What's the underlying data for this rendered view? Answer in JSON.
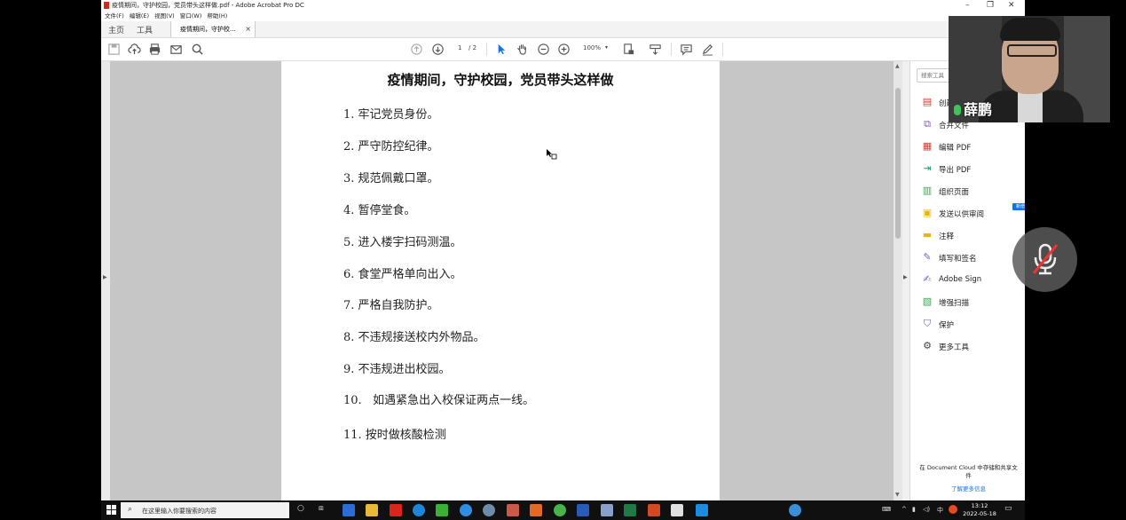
{
  "window": {
    "title": "疫情期间，守护校园，党员带头这样做.pdf - Adobe Acrobat Pro DC",
    "controls": {
      "minimize": "–",
      "restore": "❐",
      "close": "✕"
    }
  },
  "menu": [
    "文件(F)",
    "编辑(E)",
    "视图(V)",
    "窗口(W)",
    "帮助(H)"
  ],
  "tabs": {
    "home": "主页",
    "tools": "工具",
    "document": "疫情期间，守护校...",
    "close": "×"
  },
  "toolbar": {
    "page_current": "1",
    "page_total": "/ 2",
    "zoom": "100%"
  },
  "document": {
    "title": "疫情期间，守护校园，党员带头这样做",
    "items": [
      "1. 牢记党员身份。",
      "2. 严守防控纪律。",
      "3. 规范佩戴口罩。",
      "4. 暂停堂食。",
      "5. 进入楼宇扫码测温。",
      "6. 食堂严格单向出入。",
      "7. 严格自我防护。",
      "8. 不违规接送校内外物品。",
      "9. 不违规进出校园。",
      "10.   如遇紧急出入校保证两点一线。",
      "11. 按时做核酸检测"
    ]
  },
  "right_panel": {
    "search_placeholder": "搜索工具",
    "tools": [
      {
        "label": "创建 PDF",
        "icon": "create-pdf-icon",
        "color": "#e0362c"
      },
      {
        "label": "合并文件",
        "icon": "combine-files-icon",
        "color": "#7a5ac8"
      },
      {
        "label": "编辑 PDF",
        "icon": "edit-pdf-icon",
        "color": "#e0362c"
      },
      {
        "label": "导出 PDF",
        "icon": "export-pdf-icon",
        "color": "#1aa06b"
      },
      {
        "label": "组织页面",
        "icon": "organize-pages-icon",
        "color": "#36a84b"
      },
      {
        "label": "发送以供审阅",
        "icon": "send-review-icon",
        "color": "#e6b619"
      },
      {
        "label": "注释",
        "icon": "comment-icon",
        "color": "#e6b619"
      },
      {
        "label": "填写和签名",
        "icon": "fill-sign-icon",
        "color": "#7a5ac8"
      },
      {
        "label": "Adobe Sign",
        "icon": "adobe-sign-icon",
        "color": "#7a5ac8"
      },
      {
        "label": "增强扫描",
        "icon": "enhance-scan-icon",
        "color": "#36a84b"
      },
      {
        "label": "保护",
        "icon": "protect-icon",
        "color": "#6b55c3"
      },
      {
        "label": "更多工具",
        "icon": "more-tools-icon",
        "color": "#444444"
      }
    ],
    "new_badge": "新增",
    "cloud_text": "在 Document Cloud 中存储和共享文件",
    "learn_more": "了解更多信息"
  },
  "webcam": {
    "name": "薛鹏"
  },
  "taskbar": {
    "search_placeholder": "在这里输入你要搜索的内容",
    "time": "13:12",
    "date": "2022-05-18",
    "ime": "中"
  }
}
